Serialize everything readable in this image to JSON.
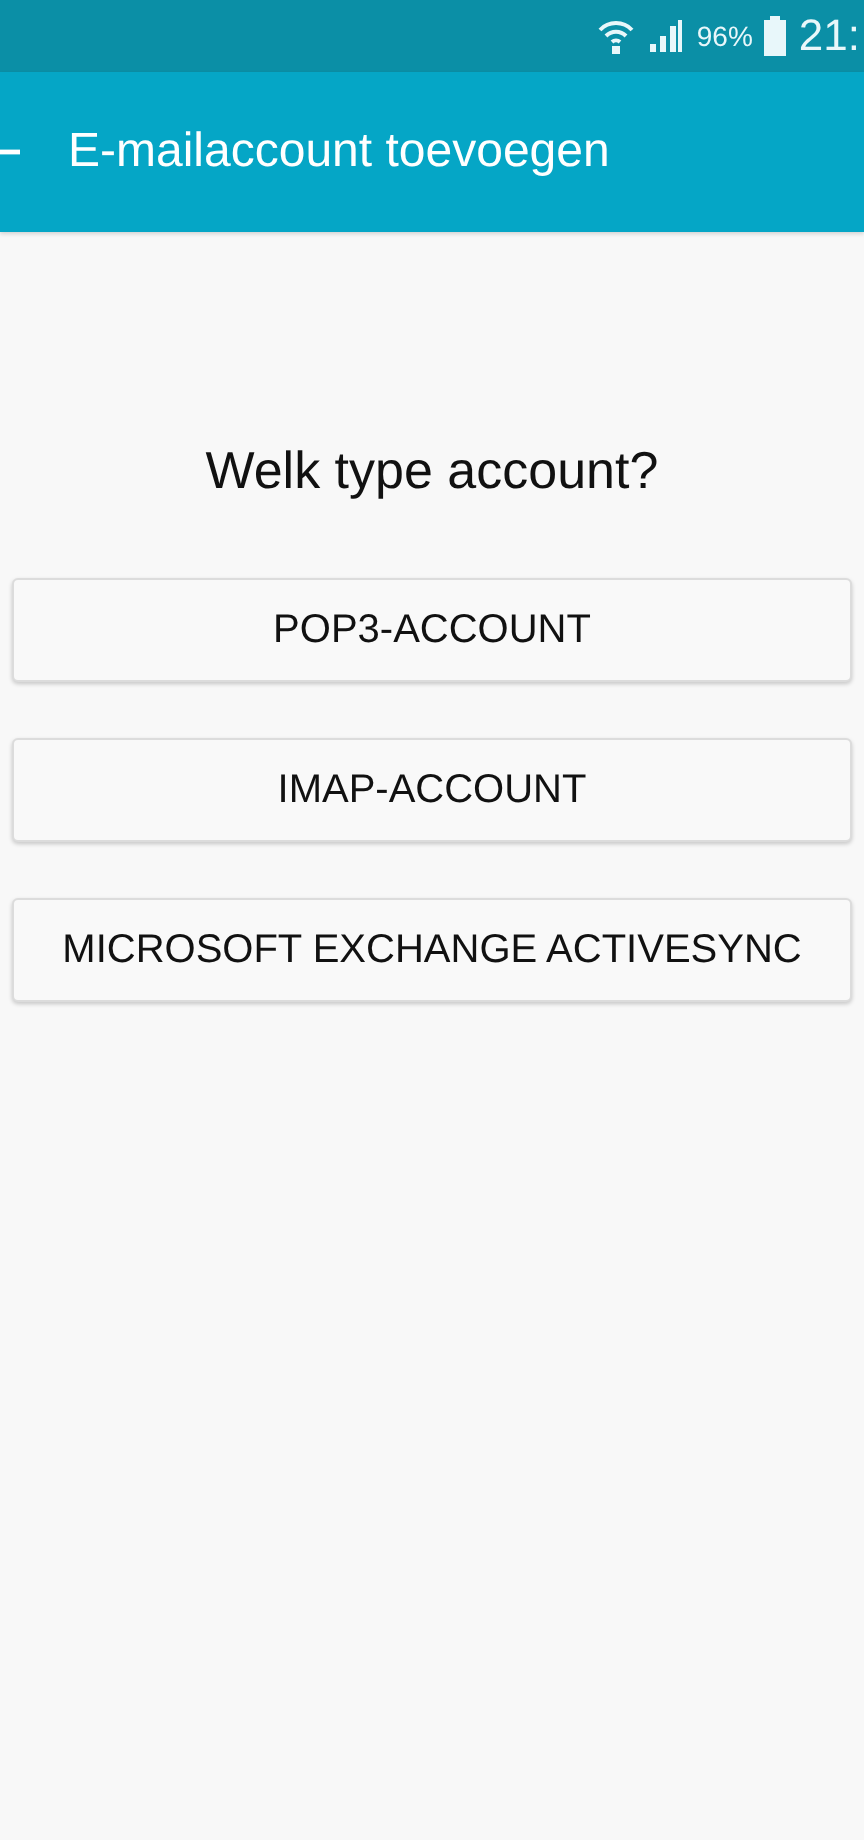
{
  "status_bar": {
    "battery_text": "96%",
    "time": "21:"
  },
  "app_bar": {
    "title": "E-mailaccount toevoegen"
  },
  "heading": "Welk type account?",
  "options": [
    {
      "label": "POP3-ACCOUNT"
    },
    {
      "label": "IMAP-ACCOUNT"
    },
    {
      "label": "MICROSOFT EXCHANGE ACTIVESYNC"
    }
  ]
}
